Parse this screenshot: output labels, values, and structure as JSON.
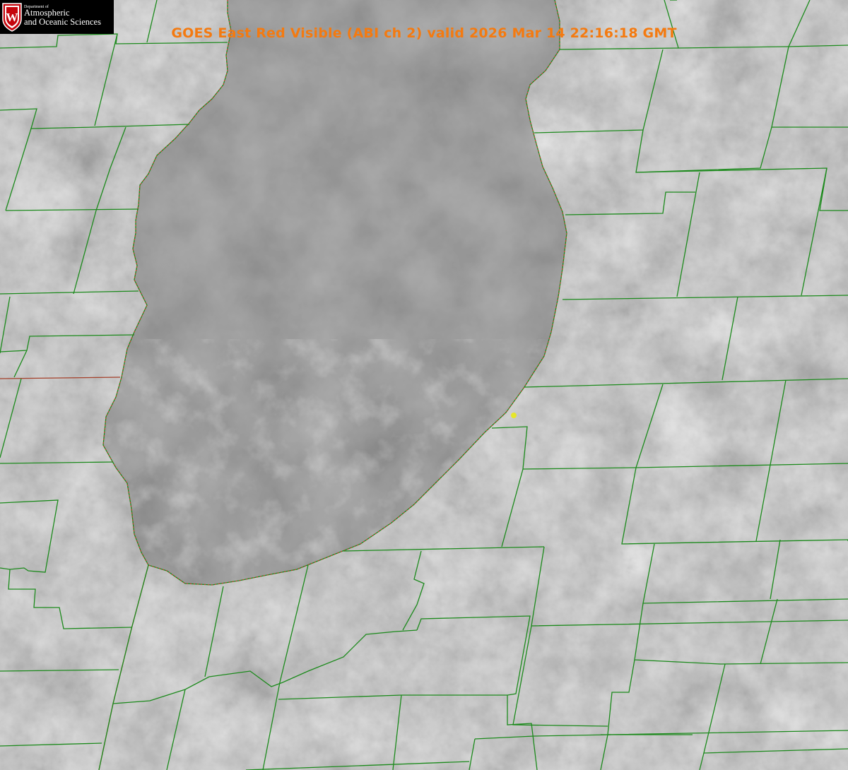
{
  "header": {
    "title": "GOES East Red Visible (ABI ch 2) valid 2026 Mar 14 22:16:18 GMT",
    "title_color": "#f47a10"
  },
  "logo": {
    "crest_letter": "W",
    "small_text": "Department of",
    "line1": "Atmospheric",
    "line2": "and Oceanic Sciences",
    "crest_color": "#c5050c",
    "text_color": "#ffffff"
  },
  "map": {
    "boundary_color": "#1c8a1c",
    "shoreline_color": "#e0302a",
    "marker_color": "#e6e62a",
    "imagery_tone": "#6e6e6e",
    "lake_tone": "#666666"
  }
}
